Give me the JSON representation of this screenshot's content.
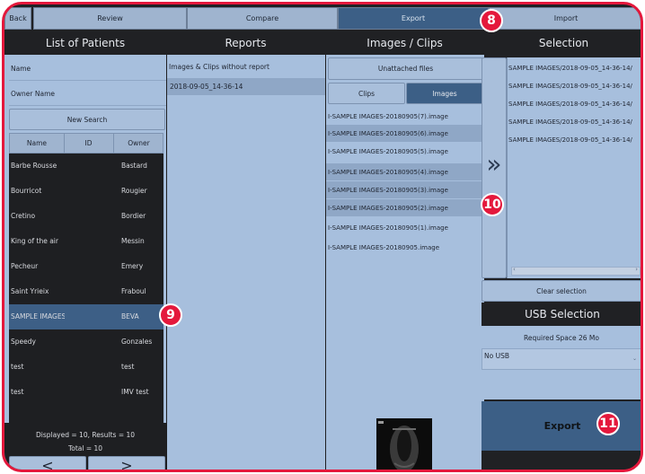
{
  "tabs": [
    {
      "label": "Back"
    },
    {
      "label": "Review"
    },
    {
      "label": "Compare"
    },
    {
      "label": "Export"
    },
    {
      "label": "Import"
    }
  ],
  "columns": {
    "patients": "List of Patients",
    "reports": "Reports",
    "images": "Images / Clips",
    "selection": "Selection"
  },
  "patients": {
    "name_placeholder": "Name",
    "owner_placeholder": "Owner Name",
    "search_label": "New Search",
    "headers": [
      "Name",
      "ID",
      "Owner"
    ],
    "rows": [
      {
        "name": "Barbe Rousse",
        "owner": "Bastard"
      },
      {
        "name": "Bourricot",
        "owner": "Rougier"
      },
      {
        "name": "Cretino",
        "owner": "Bordier"
      },
      {
        "name": "King of the air",
        "owner": "Messin"
      },
      {
        "name": "Pecheur",
        "owner": "Emery"
      },
      {
        "name": "Saint Yrieix",
        "owner": "Fraboul"
      },
      {
        "name": "SAMPLE IMAGES",
        "owner": "BEVA"
      },
      {
        "name": "Speedy",
        "owner": "Gonzales"
      },
      {
        "name": "test",
        "owner": "test"
      },
      {
        "name": "test",
        "owner": "IMV test"
      }
    ],
    "selected_index": 6,
    "displayed": "Displayed = 10, Results = 10",
    "total": "Total = 10",
    "prev": "<",
    "next": ">"
  },
  "reports": {
    "items": [
      "Images & Clips without report",
      "2018-09-05_14-36-14"
    ]
  },
  "images": {
    "unattached": "Unattached files",
    "tab_clips": "Clips",
    "tab_images": "Images",
    "files": [
      "I-SAMPLE IMAGES-20180905(7).image",
      "I-SAMPLE IMAGES-20180905(6).image",
      "I-SAMPLE IMAGES-20180905(5).image",
      "I-SAMPLE IMAGES-20180905(4).image",
      "I-SAMPLE IMAGES-20180905(3).image",
      "I-SAMPLE IMAGES-20180905(2).image",
      "I-SAMPLE IMAGES-20180905(1).image",
      "I-SAMPLE IMAGES-20180905.image"
    ],
    "highlighted": [
      1,
      3,
      4,
      5
    ]
  },
  "transfer_glyph": "»",
  "selection": {
    "items": [
      "SAMPLE IMAGES/2018-09-05_14-36-14/",
      "SAMPLE IMAGES/2018-09-05_14-36-14/",
      "SAMPLE IMAGES/2018-09-05_14-36-14/",
      "SAMPLE IMAGES/2018-09-05_14-36-14/",
      "SAMPLE IMAGES/2018-09-05_14-36-14/"
    ],
    "clear_label": "Clear selection",
    "usb_title": "USB Selection",
    "required_space": "Required Space  26 Mo",
    "usb_value": "No USB",
    "export_label": "Export"
  },
  "callouts": [
    "8",
    "9",
    "10",
    "11"
  ],
  "colors": {
    "accent": "#e4183c",
    "active_tab": "#3c5f86",
    "pane": "#a7bfdd",
    "dark": "#202124"
  }
}
